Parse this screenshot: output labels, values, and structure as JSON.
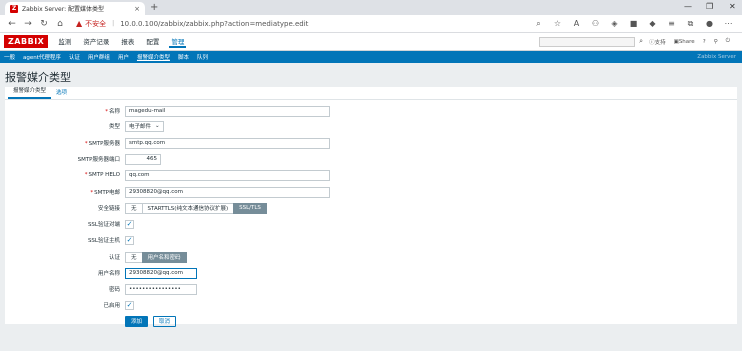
{
  "browser": {
    "tab_favicon": "Z",
    "tab_title": "Zabbix Server: 配置媒体类型",
    "tab_close": "×",
    "new_tab": "+",
    "min": "—",
    "max": "❐",
    "close": "✕",
    "insecure": "不安全",
    "url": "10.0.0.100/zabbix/zabbix.php?action=mediatype.edit"
  },
  "header": {
    "logo": "ZABBIX",
    "menu": [
      "监测",
      "资产记录",
      "报表",
      "配置",
      "管理"
    ],
    "active_menu": "管理",
    "support": "支持",
    "share": "Share",
    "help": "?"
  },
  "submenu": {
    "items": [
      "一般",
      "agent代理程序",
      "认证",
      "用户群组",
      "用户",
      "报警媒介类型",
      "脚本",
      "队列"
    ],
    "active": "报警媒介类型",
    "server_name": "Zabbix Server"
  },
  "page": {
    "title": "报警媒介类型",
    "tabs": [
      "报警媒介类型",
      "选项"
    ]
  },
  "form": {
    "name_label": "名称",
    "name_value": "magedu-mail",
    "type_label": "类型",
    "type_value": "电子邮件",
    "smtp_server_label": "SMTP服务器",
    "smtp_server_value": "smtp.qq.com",
    "smtp_port_label": "SMTP服务器端口",
    "smtp_port_value": "465",
    "smtp_helo_label": "SMTP HELO",
    "smtp_helo_value": "qq.com",
    "smtp_email_label": "SMTP电邮",
    "smtp_email_value": "29308820@qq.com",
    "security_label": "安全链接",
    "security_options": [
      "无",
      "STARTTLS(纯文本通信协议扩展)",
      "SSL/TLS"
    ],
    "ssl_peer_label": "SSL验证对端",
    "ssl_host_label": "SSL验证主机",
    "auth_label": "认证",
    "auth_options": [
      "无",
      "用户名和密码"
    ],
    "username_label": "用户名称",
    "username_value": "29308820@qq.com",
    "password_label": "密码",
    "password_value": "••••••••••••••••",
    "enabled_label": "已启用",
    "add_button": "添加",
    "cancel_button": "取消"
  }
}
